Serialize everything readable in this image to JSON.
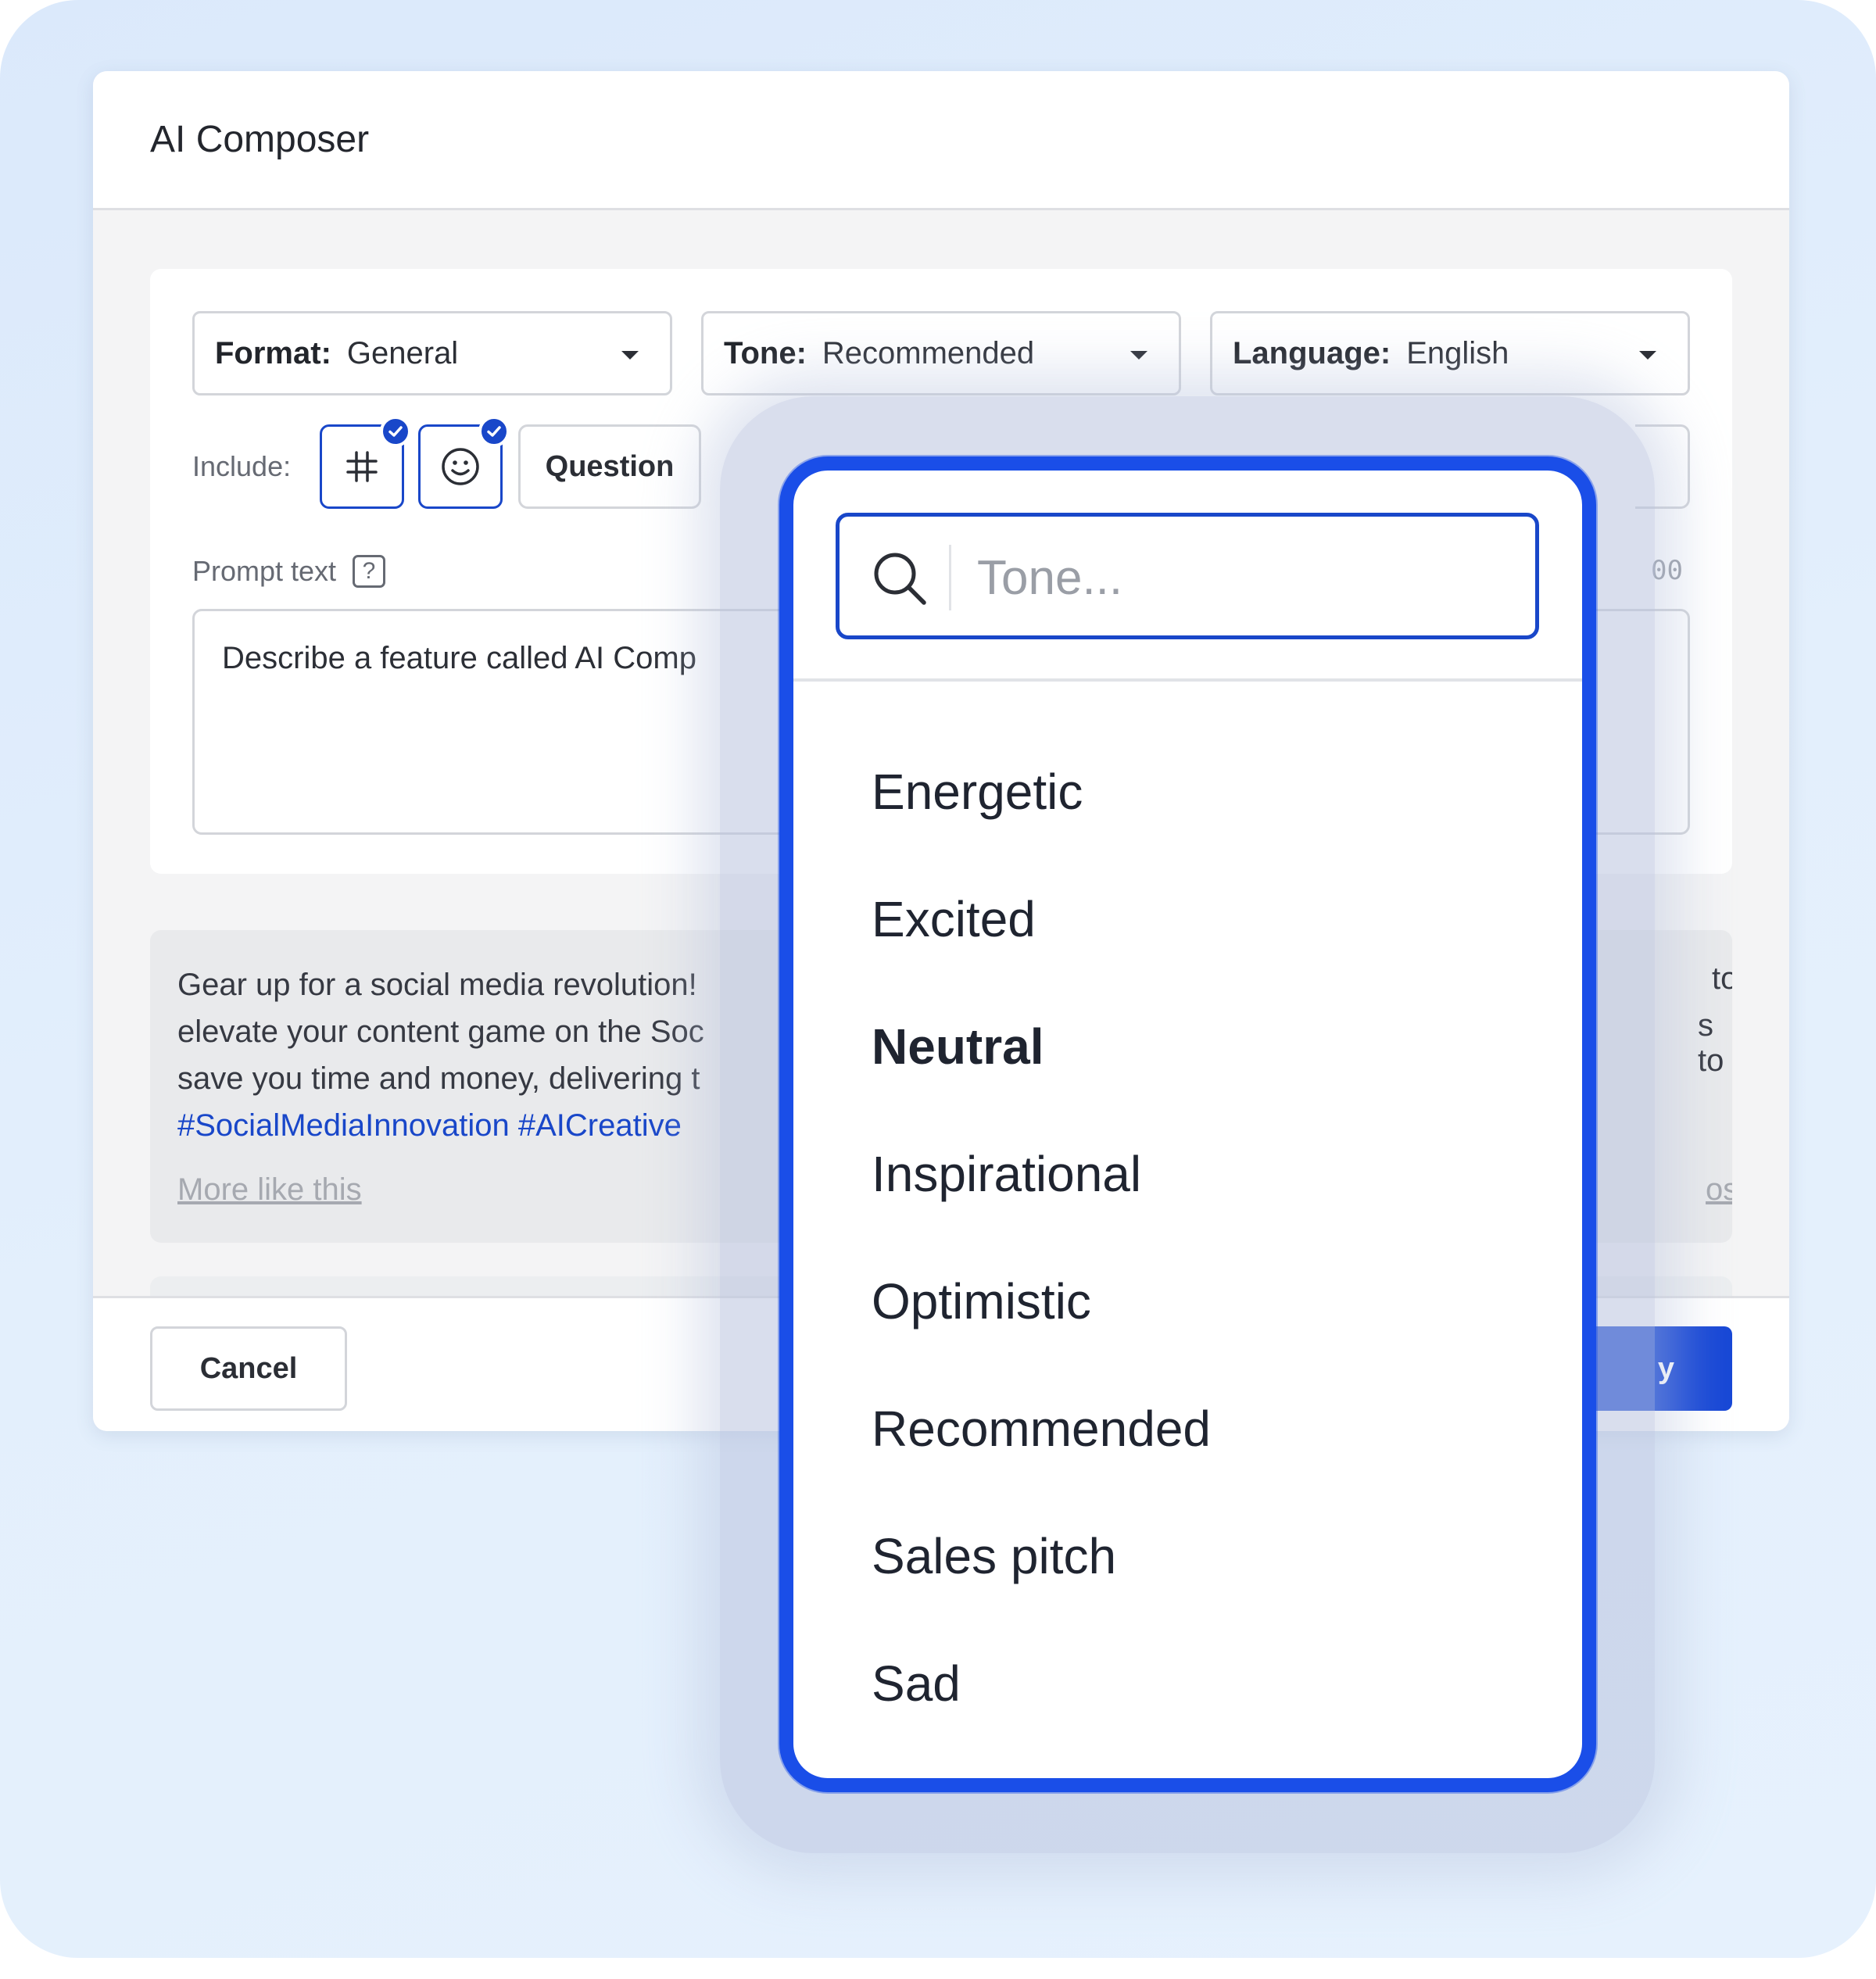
{
  "modal": {
    "title": "AI Composer"
  },
  "settings": {
    "format": {
      "label": "Format:",
      "value": "General"
    },
    "tone": {
      "label": "Tone:",
      "value": "Recommended"
    },
    "language": {
      "label": "Language:",
      "value": "English"
    },
    "include_label": "Include:",
    "include_chips": [
      {
        "icon": "hashtag-icon",
        "selected": true
      },
      {
        "icon": "smiley-icon",
        "selected": true
      },
      {
        "label": "Question",
        "selected": false
      }
    ],
    "prompt_label": "Prompt text",
    "counter_fragment": "00",
    "prompt_value": "Describe a feature called AI Comp"
  },
  "result": {
    "lines": [
      "Gear up for a social media revolution!",
      "elevate your content game on the Soc",
      "save you time and money, delivering t"
    ],
    "hashtags": "#SocialMediaInnovation #AICreative",
    "right_fragments": [
      "to",
      "s to"
    ],
    "more_like_this": "More like this",
    "post_fragment": "ost"
  },
  "footer": {
    "cancel_label": "Cancel",
    "primary_fragment": "y"
  },
  "dropdown": {
    "search_placeholder": "Tone...",
    "options": [
      {
        "label": "Energetic",
        "selected": false
      },
      {
        "label": "Excited",
        "selected": false
      },
      {
        "label": "Neutral",
        "selected": true
      },
      {
        "label": "Inspirational",
        "selected": false
      },
      {
        "label": "Optimistic",
        "selected": false
      },
      {
        "label": "Recommended",
        "selected": false
      },
      {
        "label": "Sales pitch",
        "selected": false
      },
      {
        "label": "Sad",
        "selected": false
      }
    ]
  },
  "colors": {
    "accent": "#1947c9",
    "dropdown_border": "#1a4ee8",
    "background": "#dfecfb"
  }
}
